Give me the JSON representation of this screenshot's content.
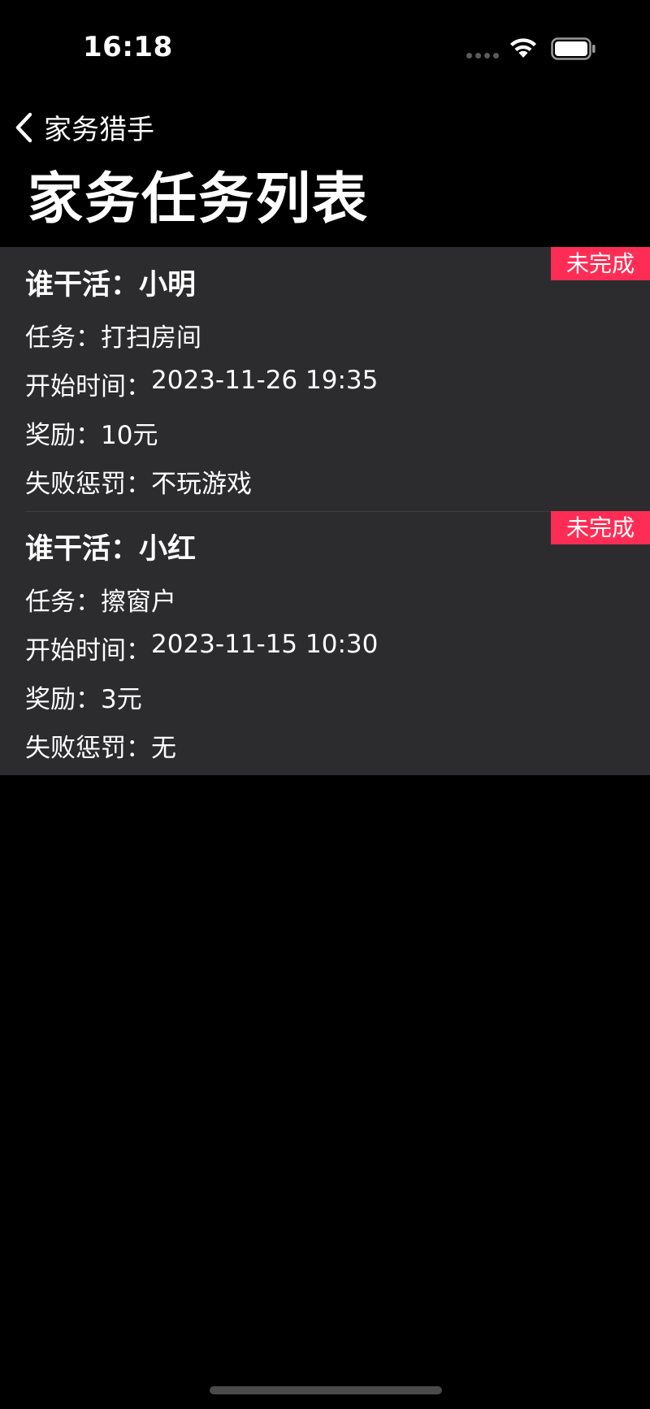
{
  "status_bar": {
    "time": "16:18"
  },
  "nav": {
    "back_label": "家务猎手"
  },
  "page": {
    "title": "家务任务列表"
  },
  "labels": {
    "worker": "谁干活：",
    "task": "任务：",
    "start_time": "开始时间：",
    "reward": "奖励：",
    "penalty": "失败惩罚："
  },
  "tasks": [
    {
      "worker": "小明",
      "task": "打扫房间",
      "start_time": "2023-11-26 19:35",
      "reward": "10元",
      "penalty": "不玩游戏",
      "status": "未完成"
    },
    {
      "worker": "小红",
      "task": "擦窗户",
      "start_time": "2023-11-15 10:30",
      "reward": "3元",
      "penalty": "无",
      "status": "未完成"
    }
  ],
  "colors": {
    "background": "#000000",
    "card": "#2c2c2e",
    "badge": "#ff2d55",
    "text": "#ffffff"
  }
}
